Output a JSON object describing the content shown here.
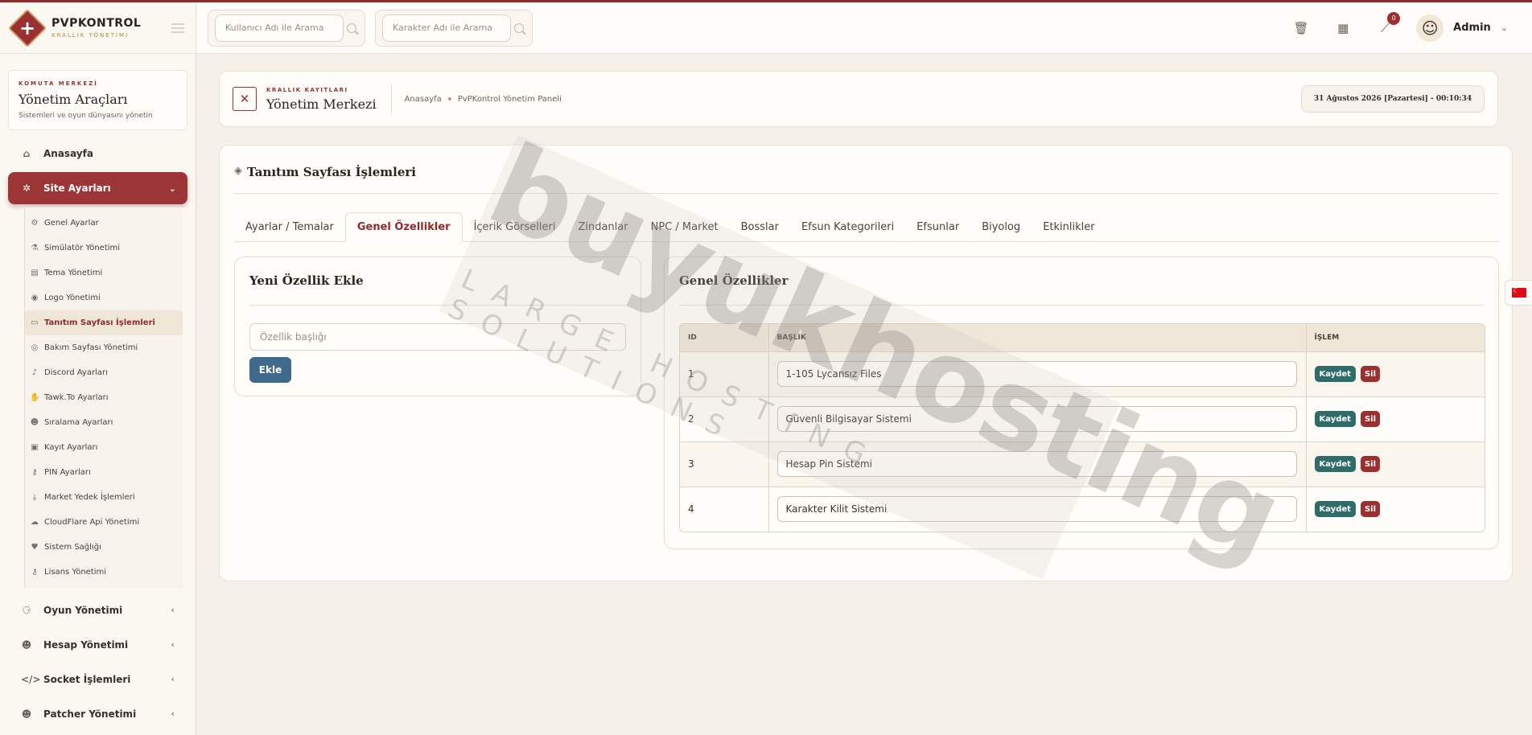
{
  "brand": {
    "title": "PVPKONTROL",
    "subtitle": "KRALLIK YÖNETİMİ"
  },
  "command_box": {
    "eyebrow": "KOMUTA MERKEZİ",
    "title": "Yönetim Araçları",
    "subtitle": "Sistemleri ve oyun dünyasını yönetin"
  },
  "sidebar": {
    "home": {
      "label": "Anasayfa",
      "icon": "home-icon"
    },
    "site_settings": {
      "label": "Site Ayarları",
      "icon": "gear-icon"
    },
    "sub_items": [
      {
        "label": "Genel Ayarlar",
        "icon": "gears-icon"
      },
      {
        "label": "Simülatör Yönetimi",
        "icon": "flask-icon"
      },
      {
        "label": "Tema Yönetimi",
        "icon": "file-icon"
      },
      {
        "label": "Logo Yönetimi",
        "icon": "eye-icon"
      },
      {
        "label": "Tanıtım Sayfası İşlemleri",
        "icon": "monitor-icon"
      },
      {
        "label": "Bakım Sayfası Yönetimi",
        "icon": "eye-slash-icon"
      },
      {
        "label": "Discord Ayarları",
        "icon": "microphone-icon"
      },
      {
        "label": "Tawk.To Ayarları",
        "icon": "handshake-icon"
      },
      {
        "label": "Sıralama Ayarları",
        "icon": "users-icon"
      },
      {
        "label": "Kayıt Ayarları",
        "icon": "id-card-icon"
      },
      {
        "label": "PIN Ayarları",
        "icon": "key-icon"
      },
      {
        "label": "Market Yedek İşlemleri",
        "icon": "download-icon"
      },
      {
        "label": "CloudFlare Api Yönetimi",
        "icon": "cloud-icon"
      },
      {
        "label": "Sistem Sağlığı",
        "icon": "heartbeat-icon"
      },
      {
        "label": "Lisans Yönetimi",
        "icon": "key-icon"
      }
    ],
    "bottom_items": [
      {
        "label": "Oyun Yönetimi",
        "icon": "gamepad-icon"
      },
      {
        "label": "Hesap Yönetimi",
        "icon": "users-icon"
      },
      {
        "label": "Socket İşlemleri",
        "icon": "code-icon"
      },
      {
        "label": "Patcher Yönetimi",
        "icon": "users-icon"
      }
    ]
  },
  "topbar": {
    "search_user_placeholder": "Kullanıcı Adı ile Arama",
    "search_char_placeholder": "Karakter Adı ile Arama",
    "notification_count": "0",
    "admin_name": "Admin"
  },
  "header": {
    "eyebrow": "KRALLIK KAYITLARI",
    "title": "Yönetim Merkezi",
    "breadcrumb_home": "Anasayfa",
    "breadcrumb_current": "PvPKontrol Yönetim Paneli",
    "date": "31 Ağustos 2026 [Pazartesi] - 00:10:34"
  },
  "main": {
    "title": "Tanıtım Sayfası İşlemleri",
    "tabs": [
      {
        "label": "Ayarlar / Temalar"
      },
      {
        "label": "Genel Özellikler"
      },
      {
        "label": "İçerik Görselleri"
      },
      {
        "label": "Zindanlar"
      },
      {
        "label": "NPC / Market"
      },
      {
        "label": "Bosslar"
      },
      {
        "label": "Efsun Kategorileri"
      },
      {
        "label": "Efsunlar"
      },
      {
        "label": "Biyolog"
      },
      {
        "label": "Etkinlikler"
      }
    ],
    "active_tab": "Genel Özellikler"
  },
  "add_panel": {
    "title": "Yeni Özellik Ekle",
    "input_placeholder": "Özellik başlığı",
    "add_label": "Ekle"
  },
  "features_panel": {
    "title": "Genel Özellikler",
    "columns": [
      "ID",
      "BAŞLIK",
      "İŞLEM"
    ],
    "rows": [
      {
        "id": "1",
        "title": "1-105 Lycansız Files"
      },
      {
        "id": "2",
        "title": "Güvenli Bilgisayar Sistemi"
      },
      {
        "id": "3",
        "title": "Hesap Pin Sistemi"
      },
      {
        "id": "4",
        "title": "Karakter Kilit Sistemi"
      }
    ],
    "save_label": "Kaydet",
    "delete_label": "Sil"
  },
  "watermark": {
    "main": "buyukhosting",
    "sub": "LARGE HOSTING SOLUTIONS"
  },
  "colors": {
    "accent": "#9c2f2f",
    "save": "#2f6b68",
    "add": "#3f6a8c"
  }
}
